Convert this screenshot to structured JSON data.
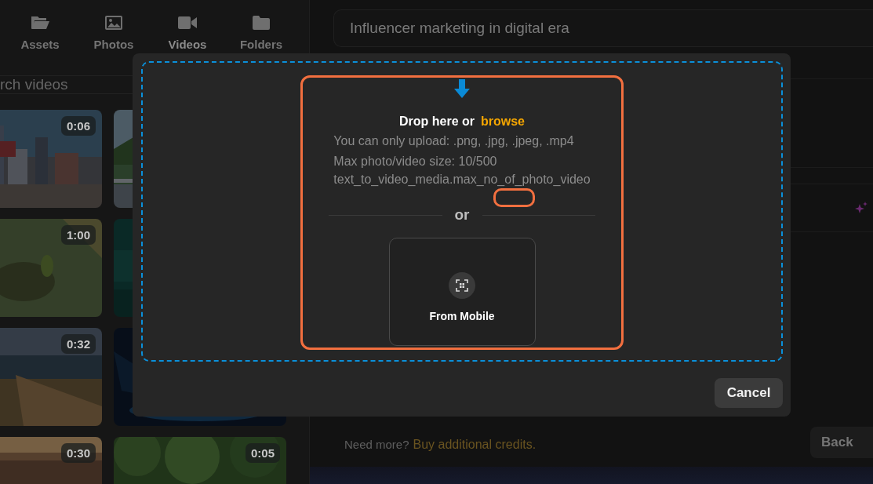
{
  "nav_tabs": [
    {
      "label": "Assets",
      "selected": false
    },
    {
      "label": "Photos",
      "selected": false
    },
    {
      "label": "Videos",
      "selected": true
    },
    {
      "label": "Folders",
      "selected": false
    }
  ],
  "search": {
    "placeholder": "rch videos"
  },
  "thumbnails": [
    {
      "kind": "picture",
      "duration": "0:06"
    },
    {
      "kind": "picture"
    },
    {
      "kind": "picture",
      "duration": "1:00"
    },
    {
      "kind": "picture"
    },
    {
      "kind": "picture",
      "duration": "0:32"
    },
    {
      "kind": "picture"
    },
    {
      "kind": "picture",
      "duration": "0:30"
    },
    {
      "kind": "picture",
      "duration": "0:05"
    }
  ],
  "title_field": {
    "value": "Influencer marketing in digital era"
  },
  "quota": {
    "text": "Need more?",
    "link": "Buy additional credits."
  },
  "back_button": "Back",
  "upload_dialog": {
    "heading": "Drop here or",
    "browse": "browse",
    "lines": [
      "You can only upload: .png, .jpg, .jpeg, .mp4",
      "Max photo/video size: 10/500",
      "text_to_video_media.max_no_of_photo_video"
    ],
    "divider": "or",
    "mobile_button": "From Mobile",
    "cancel_button": "Cancel"
  }
}
